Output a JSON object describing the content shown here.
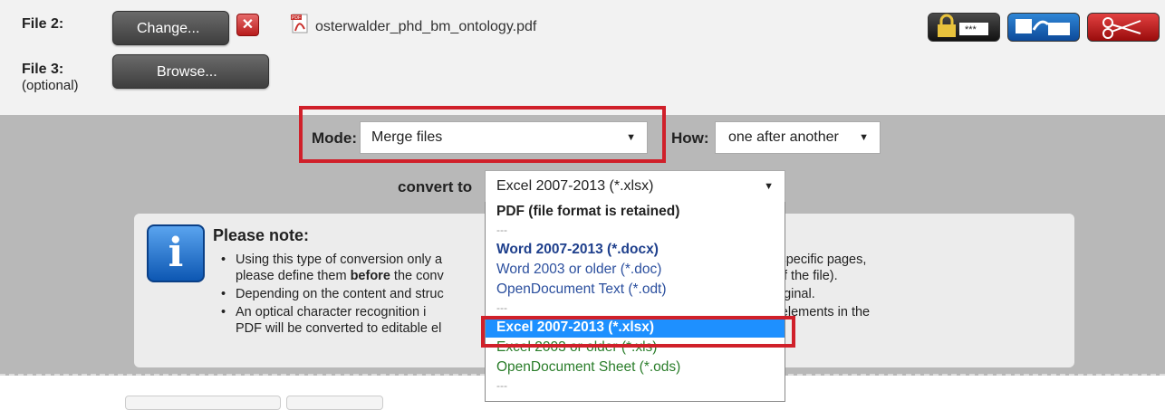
{
  "files": {
    "file2_label": "File 2:",
    "file2_change_btn": "Change...",
    "file2_name": "osterwalder_phd_bm_ontology.pdf",
    "file3_label": "File 3:",
    "file3_sub": "(optional)",
    "file3_browse_btn": "Browse..."
  },
  "toolbar_icons": [
    "lock-password-icon",
    "convert-arrow-icon",
    "scissors-icon"
  ],
  "options": {
    "mode_label": "Mode:",
    "mode_value": "Merge files",
    "how_label": "How:",
    "how_value": "one after another",
    "convert_label": "convert to",
    "convert_value": "Excel 2007-2013 (*.xlsx)"
  },
  "note": {
    "title": "Please note:",
    "b1_part1": "Using this type of conversion only a",
    "b1_part2": "f you need only specific pages,",
    "b1_line2_a": "please define them ",
    "b1_line2_bold": "before",
    "b1_line2_b": " the conv",
    "b1_line2_c": "ght of the file).",
    "b2_part1": "Depending on the content and struc",
    "b2_part2": "differ from the original.",
    "b3_part1": "An optical character recognition i",
    "b3_part2": "al text and table elements in the",
    "b3_line2_a": "PDF will be converted to editable ",
    "b3_line2_b": "el"
  },
  "dropdown_options": [
    {
      "label": "PDF (file format is retained)"
    },
    {
      "label": "---"
    },
    {
      "label": "Word 2007-2013 (*.docx)"
    },
    {
      "label": "Word 2003 or older (*.doc)"
    },
    {
      "label": "OpenDocument Text (*.odt)"
    },
    {
      "label": "---"
    },
    {
      "label": "Excel 2007-2013 (*.xlsx)"
    },
    {
      "label": "Excel 2003 or older (*.xls)"
    },
    {
      "label": "OpenDocument Sheet (*.ods)"
    },
    {
      "label": "---"
    }
  ],
  "colors": {
    "highlight_red": "#d0202a",
    "selected_blue": "#1e90ff"
  }
}
